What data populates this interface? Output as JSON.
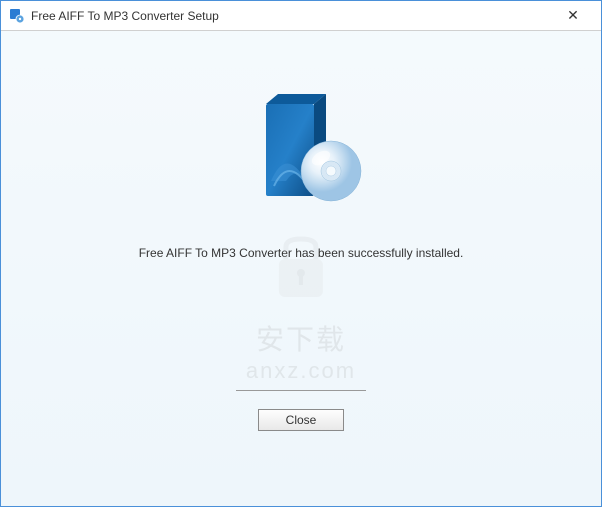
{
  "titlebar": {
    "title": "Free AIFF To MP3 Converter Setup",
    "close_symbol": "✕"
  },
  "content": {
    "message": "Free AIFF To MP3 Converter has been successfully installed.",
    "close_button_label": "Close"
  },
  "watermark": {
    "text_cn": "安下载",
    "text_domain": "anxz.com"
  },
  "icons": {
    "app_icon": "app-icon",
    "software_box": "software-box-icon",
    "disc": "disc-icon"
  }
}
